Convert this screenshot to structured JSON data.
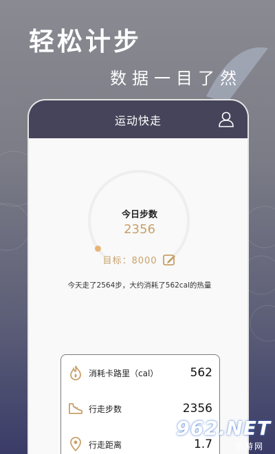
{
  "promo": {
    "title": "轻松计步",
    "subtitle": "数据一目了然"
  },
  "app": {
    "title": "运动快走",
    "user_icon": "user-icon"
  },
  "gauge": {
    "title": "今日步数",
    "value": "2356",
    "goal_text": "目标：8000",
    "progress": 0.29
  },
  "summary": "今天走了2564步，大约消耗了562cal的热量",
  "stats": [
    {
      "icon": "fire-icon",
      "label": "消耗卡路里（cal）",
      "value": "562"
    },
    {
      "icon": "shoe-icon",
      "label": "行走步数",
      "value": "2356"
    },
    {
      "icon": "location-pin-icon",
      "label": "行走距离",
      "value": "1.7"
    }
  ],
  "colors": {
    "accent": "#c8a068",
    "header": "#45445a",
    "gauge_track": "#eeeeee"
  },
  "watermark": {
    "logo": "962.NET",
    "sub": "乐游网"
  }
}
